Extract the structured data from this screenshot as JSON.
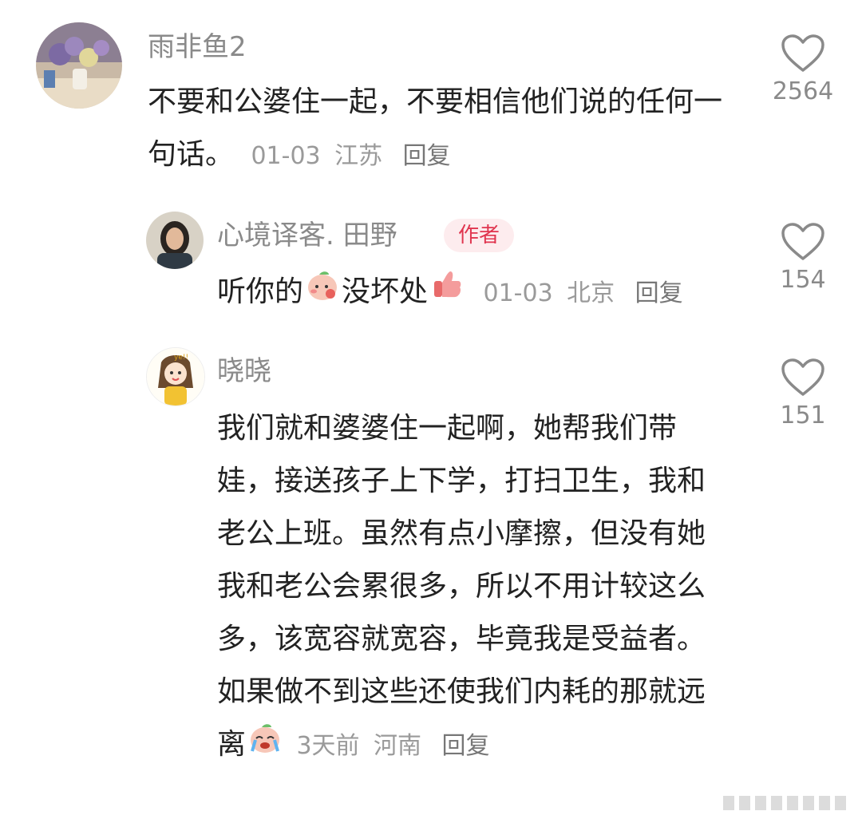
{
  "comments": [
    {
      "username": "雨非鱼2",
      "text": "不要和公婆住一起，不要相信他们说的任何一句话。",
      "date": "01-03",
      "location": "江苏",
      "reply_label": "回复",
      "likes": "2564",
      "avatar_icon": "flowers-photo-avatar"
    },
    {
      "username": "心境译客. 田野",
      "badge": "作者",
      "text_part1": "听你的",
      "text_part2": "没坏处",
      "date": "01-03",
      "location": "北京",
      "reply_label": "回复",
      "likes": "154",
      "avatar_icon": "woman-portrait-avatar",
      "emoji1": "blush-face-emoji",
      "emoji2": "thumbs-up-emoji"
    },
    {
      "username": "晓晓",
      "text": "我们就和婆婆住一起啊，她帮我们带娃，接送孩子上下学，打扫卫生，我和老公上班。虽然有点小摩擦，但没有她我和老公会累很多，所以不用计较这么多，该宽容就宽容，毕竟我是受益者。如果做不到这些还使我们内耗的那就远离",
      "date": "3天前",
      "location": "河南",
      "reply_label": "回复",
      "likes": "151",
      "avatar_icon": "cartoon-girl-avatar",
      "emoji": "crying-face-emoji"
    }
  ],
  "colors": {
    "username": "#8a8a8a",
    "text": "#222222",
    "meta": "#9a9a9a",
    "badge_bg": "#fdecee",
    "badge_text": "#e0354f"
  }
}
